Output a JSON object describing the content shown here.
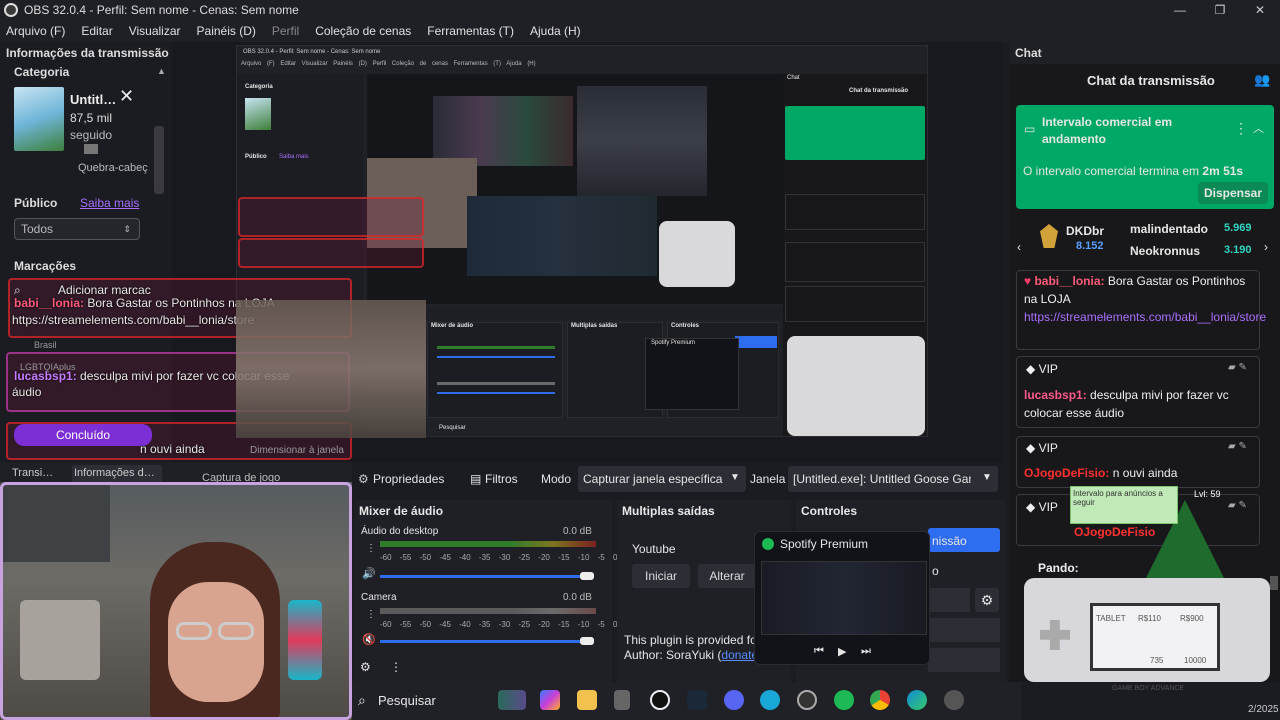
{
  "window": {
    "title": "OBS 32.0.4 - Perfil: Sem nome - Cenas: Sem nome",
    "controls": [
      "—",
      "❐",
      "✕"
    ]
  },
  "menu": [
    "Arquivo (F)",
    "Editar",
    "Visualizar",
    "Painéis (D)",
    "Perfil",
    "Coleção de cenas",
    "Ferramentas (T)",
    "Ajuda (H)"
  ],
  "left": {
    "header": "Informações da transmissão",
    "category_label": "Categoria",
    "category_name": "Untitl…",
    "category_viewers": "87,5 mil",
    "category_followers_label": "seguido",
    "category_tag": "Quebra-cabeç",
    "public_label": "Público",
    "learn_more": "Saiba mais",
    "public_value": "Todos",
    "markers_label": "Marcações",
    "add_marker": "Adicionar marcac",
    "done_button": "Concluído"
  },
  "preview_tabs": {
    "transition": "Transi…",
    "stream_info": "Informações d…",
    "capture": "Captura de jogo",
    "resize": "Dimensionar à janela"
  },
  "nested": {
    "title": "OBS 32.0.4 - Perfil: Sem nome - Cenas: Sem nome",
    "menu": "Arquivo (F) Editar Visualizar Painéis (D) Perfil Coleção de cenas Ferramentas (T) Ajuda (H)",
    "category_label": "Categoria",
    "public_label": "Público",
    "learn_more": "Saiba mais",
    "chat_label": "Chat",
    "chat_title": "Chat da transmissão",
    "search": "Pesquisar",
    "mixer": "Mixer de áudio",
    "outputs": "Multiplas saídas",
    "controls": "Controles",
    "spotify": "Spotify Premium"
  },
  "overlay_chat": [
    {
      "user": "babi__lonia:",
      "text": "Bora Gastar os Pontinhos na LOJA"
    },
    {
      "user": "",
      "text": "https://streamelements.com/babi__lonia/store"
    },
    {
      "user": "lucasbsp1:",
      "text": "desculpa mivi por fazer vc colocar esse"
    },
    {
      "user": "",
      "text": "áudio"
    },
    {
      "user": "",
      "text": "n ouvi ainda"
    }
  ],
  "overlay_misc": {
    "country": "Brasil",
    "lgbt": "LGBTQIAplus"
  },
  "toolbar": {
    "properties": "Propriedades",
    "filters": "Filtros",
    "mode_label": "Modo",
    "mode_value": "Capturar janela específica",
    "window_label": "Janela",
    "window_value": "[Untitled.exe]: Untitled Goose Game"
  },
  "mixer": {
    "title": "Mixer de áudio",
    "desktop_label": "Áudio do desktop",
    "desktop_db": "0.0 dB",
    "camera_label": "Camera",
    "camera_db": "0.0 dB",
    "scale": "-60 -55 -50 -45 -40 -35 -30 -25 -20 -15 -10 -5 0"
  },
  "outputs": {
    "title": "Multiplas saídas",
    "youtube": "Youtube",
    "start": "Iniciar",
    "change": "Alterar",
    "plugin_text": "This plugin is provided for",
    "author": "Author: SoraYuki (",
    "donate": "donate",
    "author_end": ")"
  },
  "controls": {
    "title": "Controles",
    "start_stream_fragment": "nissão",
    "frag_o": "o",
    "frag_l": "l",
    "frag_s": "s"
  },
  "spotify": {
    "title": "Spotify Premium"
  },
  "chat": {
    "panel_title": "Chat",
    "header": "Chat da transmissão",
    "ad_title": "Intervalo comercial em andamento",
    "ad_body_prefix": "O intervalo comercial termina em ",
    "ad_time": "2m 51s",
    "dismiss": "Dispensar",
    "leader1": "DKDbr",
    "leader1_pts": "8.152",
    "leader2": "malindentado",
    "leader2_pts": "5.969",
    "leader3": "Neokronnus",
    "leader3_pts": "3.190",
    "msg1_user": "babi__lonia:",
    "msg1_text": "Bora Gastar os Pontinhos na LOJA",
    "msg1_link": "https://streamelements.com/babi__lonia/store",
    "vip": "VIP",
    "msg2_user": "lucasbsp1:",
    "msg2_text": "desculpa mivi por fazer vc colocar esse áudio",
    "msg3_user": "OJogoDeFisio:",
    "msg3_text": "n ouvi ainda",
    "msg4_user": "OJogoDeFisio",
    "msg5_user": "Pando:",
    "clock": "2/2025"
  },
  "overlay_note": {
    "text": "Intervalo para anúncios a seguir",
    "level": "Lvl: 59"
  },
  "gameboy": {
    "brand": "GAME BOY ADVANCE",
    "tablet": "TABLET",
    "p1": "R$110",
    "p2": "R$900",
    "p3": "735",
    "p4": "10000"
  },
  "taskbar": {
    "search": "Pesquisar"
  },
  "colors": {
    "accent": "#2f6df0",
    "ad_green": "#00a866",
    "twitch_purple": "#9147ff",
    "vip_pink": "#e005b9"
  }
}
